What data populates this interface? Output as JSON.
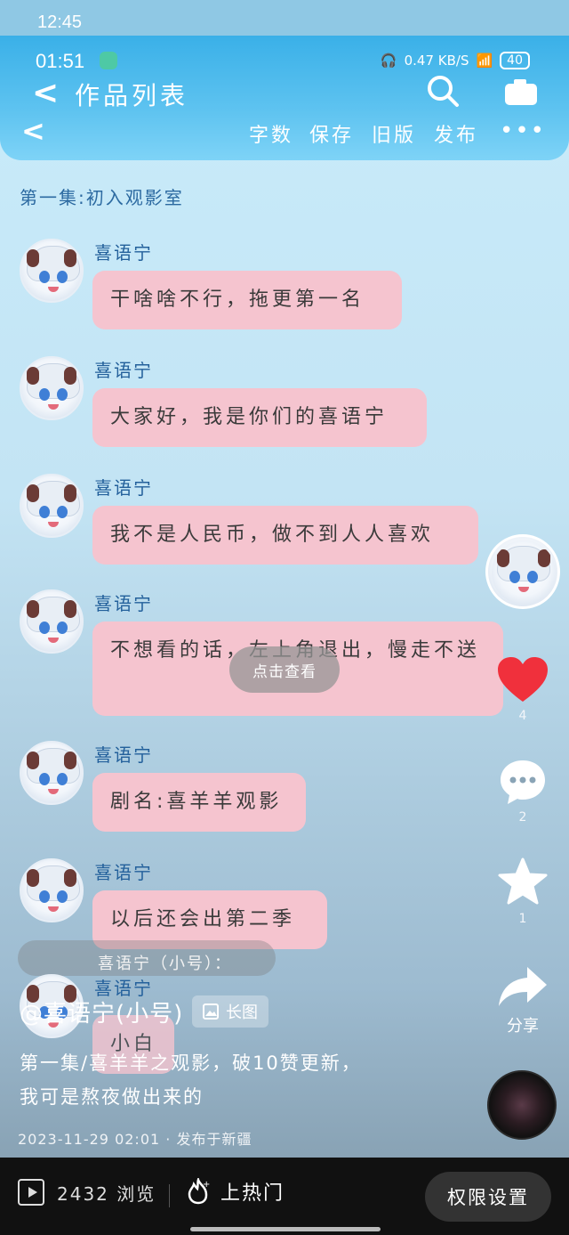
{
  "outer_status": {
    "time": "12:45"
  },
  "inner_status": {
    "time": "01:51",
    "speed": "0.47 KB/S",
    "battery": "40"
  },
  "header": {
    "title": "作品列表",
    "toolbar": [
      "字数",
      "保存",
      "旧版",
      "发布"
    ],
    "more": "•••"
  },
  "episode_title": "第一集:初入观影室",
  "messages": [
    {
      "name": "喜语宁",
      "text": "干啥啥不行，拖更第一名"
    },
    {
      "name": "喜语宁",
      "text": "大家好，我是你们的喜语宁"
    },
    {
      "name": "喜语宁",
      "text": "我不是人民币，做不到人人喜欢"
    },
    {
      "name": "喜语宁",
      "text": "不想看的话，左上角退出，慢走不送"
    },
    {
      "name": "喜语宁",
      "text": "剧名:喜羊羊观影"
    },
    {
      "name": "喜语宁",
      "text": "以后还会出第二季"
    },
    {
      "name": "喜语宁",
      "text": "小白"
    }
  ],
  "toast": "点击查看",
  "side_actions": {
    "likes": "4",
    "comments": "2",
    "favorites": "1",
    "share": "分享"
  },
  "overlay": {
    "author": "@喜语宁(小号)",
    "tag": "长图",
    "ghost_author": "喜语宁（小号）：",
    "desc_line1": "第一集/喜羊羊之观影，破10赞更新，",
    "desc_line2": "我可是熬夜做出来的",
    "meta": "2023-11-29 02:01 · 发布于新疆"
  },
  "bottom": {
    "views": "2432 浏览",
    "hot": "上热门",
    "permissions": "权限设置"
  },
  "colors": {
    "appbar": "#3ab0e8",
    "bubble": "#f5c4cf",
    "name": "#23609b",
    "like": "#f0303c"
  }
}
